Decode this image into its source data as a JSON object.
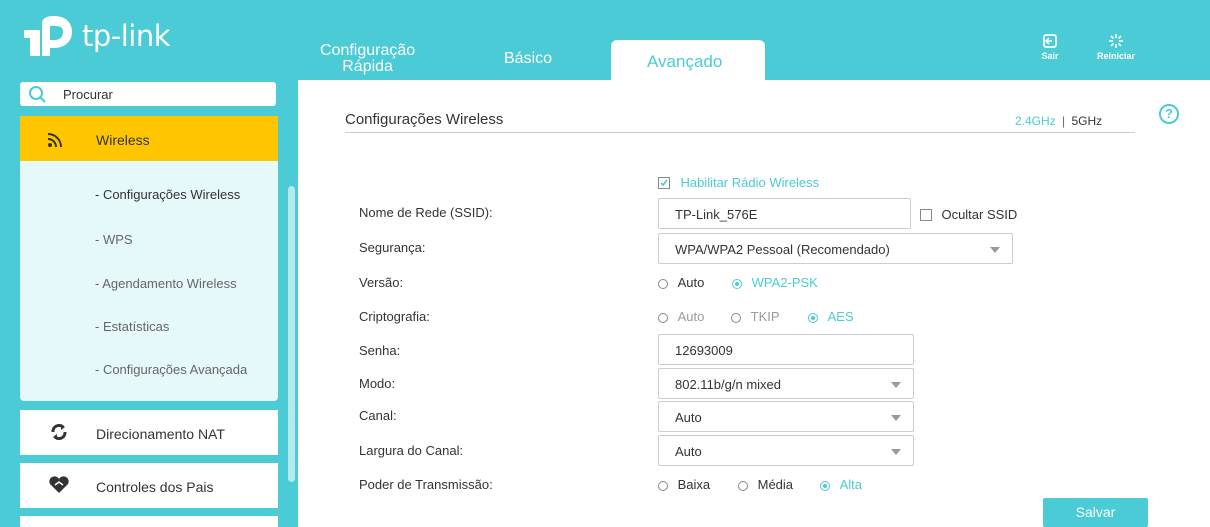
{
  "brand": {
    "name": "tp-link"
  },
  "nav": {
    "quick_setup_line1": "Configuração",
    "quick_setup_line2": "Rápida",
    "basic": "Básico",
    "advanced": "Avançado"
  },
  "top_actions": {
    "logout": "Sair",
    "reboot": "Reiniciar"
  },
  "search": {
    "label": "Procurar"
  },
  "sidebar": {
    "wireless": "Wireless",
    "sub_items": [
      "- Configurações Wireless",
      "- WPS",
      "- Agendamento Wireless",
      "- Estatísticas",
      "- Configurações Avançada"
    ],
    "nat": "Direcionamento NAT",
    "parental": "Controles dos Pais"
  },
  "page": {
    "title": "Configurações Wireless",
    "band_24": "2.4GHz",
    "band_sep": "|",
    "band_5": "5GHz",
    "help": "?"
  },
  "form": {
    "enable_radio": "Habilitar Rádio Wireless",
    "ssid_label": "Nome de Rede (SSID):",
    "ssid_value": "TP-Link_576E",
    "hide_ssid": "Ocultar SSID",
    "security_label": "Segurança:",
    "security_value": "WPA/WPA2 Pessoal (Recomendado)",
    "version_label": "Versão:",
    "version_auto": "Auto",
    "version_wpa2": "WPA2-PSK",
    "crypto_label": "Criptografia:",
    "crypto_auto": "Auto",
    "crypto_tkip": "TKIP",
    "crypto_aes": "AES",
    "password_label": "Senha:",
    "password_value": "12693009",
    "mode_label": "Modo:",
    "mode_value": "802.11b/g/n mixed",
    "channel_label": "Canal:",
    "channel_value": "Auto",
    "width_label": "Largura do Canal:",
    "width_value": "Auto",
    "power_label": "Poder de Transmissão:",
    "power_low": "Baixa",
    "power_mid": "Média",
    "power_high": "Alta",
    "save": "Salvar"
  },
  "colors": {
    "accent": "#4acbd6",
    "active_menu": "#ffc600"
  }
}
